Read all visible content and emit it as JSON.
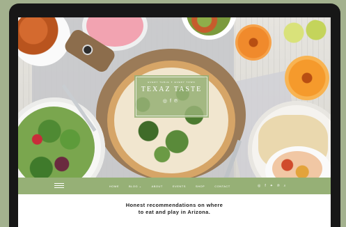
{
  "brand": {
    "subtitle": "EVERY TABLE ✦ EVERY TOWN",
    "title": "TEXAZ TASTE",
    "social_icons": [
      "instagram-icon",
      "facebook-icon",
      "pinterest-icon"
    ]
  },
  "nav": {
    "menu_icon": "hamburger-menu-icon",
    "items": [
      {
        "label": "HOME"
      },
      {
        "label": "BLOG ⌄"
      },
      {
        "label": "ABOUT"
      },
      {
        "label": "EVENTS"
      },
      {
        "label": "SHOP"
      },
      {
        "label": "CONTACT"
      }
    ],
    "social": [
      {
        "icon": "instagram-icon",
        "glyph": "◎"
      },
      {
        "icon": "facebook-icon",
        "glyph": "f"
      },
      {
        "icon": "twitter-icon",
        "glyph": "✦"
      },
      {
        "icon": "pinterest-icon",
        "glyph": "℗"
      },
      {
        "icon": "search-icon",
        "glyph": "⌕"
      }
    ]
  },
  "tagline": {
    "line1": "Honest recommendations on where",
    "line2": "to eat and play in Arizona."
  },
  "colors": {
    "background": "#a3b18e",
    "nav_bar": "#96b076",
    "device_frame": "#171717"
  }
}
